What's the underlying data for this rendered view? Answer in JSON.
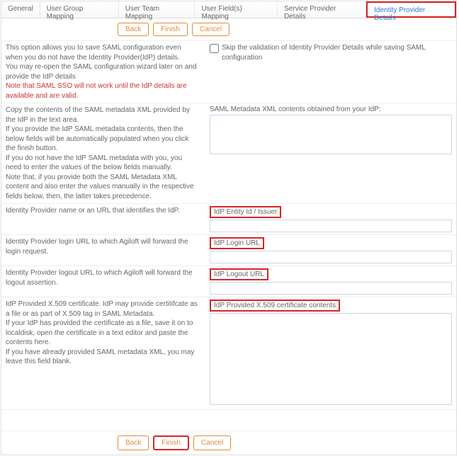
{
  "tabs": {
    "general": "General",
    "userGroup": "User Group Mapping",
    "userTeam": "User Team Mapping",
    "userFields": "User Field(s) Mapping",
    "spd": "Service Provider Details",
    "ipd": "Identity Provider Details"
  },
  "buttons": {
    "back": "Back",
    "finish": "Finish",
    "cancel": "Cancel"
  },
  "intro": {
    "l1": "This option allows you to save SAML configuration even when you do not have the Identity Provider(IdP) details.",
    "l2": "You may re-open the SAML configuration wizard later on and provide the IdP details",
    "warn": "Note that SAML SSO will not work until the IdP details are available and are valid."
  },
  "skipValidation": "Skip the validation of Identity Provider Details while saving SAML configuration",
  "metaHelp": {
    "l1": "Copy the contents of the SAML metadata XML provided by the IdP in the text area.",
    "l2": "If you provide the IdP SAML metadata contents, then the below fields will be automatically populated when you click the finish button.",
    "l3": "If you do not have the IdP SAML metadata with you, you need to enter the values of the below fields manually.",
    "l4": "Note that, if you provide both the SAML Metadata XML content and also enter the values manually in the respective fields below, then, the latter takes precedence."
  },
  "metaLabel": "SAML Metadata XML contents obtained from your IdP:",
  "fields": {
    "entity": {
      "help": "Identity Provider name or an URL that identifies the IdP.",
      "label": "IdP Entity Id / Issuer"
    },
    "login": {
      "help": "Identity Provider login URL to which Agiloft will forward the login request.",
      "label": "IdP Login URL"
    },
    "logout": {
      "help": "Identity Provider logout URL to which Agiloft will forward the logout assertion.",
      "label": "IdP Logout URL"
    },
    "cert": {
      "help1": "IdP Provided X.509 certificate. IdP may provide certitifcate as a file or as part of X.509 tag in SAML Metadata.",
      "help2": "If your IdP has provided the certificate as a file, save it on to localdisk, open the certificate in a text editor and paste the contents here.",
      "help3": "If you have already provided SAML metadata XML, you may leave this field blank.",
      "label": "IdP Provided X.509 certificate contents"
    }
  }
}
